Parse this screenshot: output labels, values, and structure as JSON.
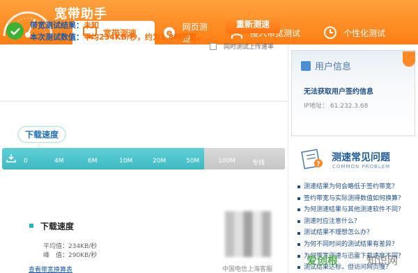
{
  "app": {
    "title": "宽带助手"
  },
  "tabs": [
    {
      "label": "宽带测速",
      "icon": "monitor-icon",
      "active": true
    },
    {
      "label": "网页测速",
      "icon": "browser-e-icon",
      "active": false
    },
    {
      "label": "接入带宽测试",
      "icon": "person-upload-icon",
      "active": false
    },
    {
      "label": "个性化测试",
      "icon": "clock-icon",
      "active": false
    }
  ],
  "result": {
    "result_label": "带宽测试结果：",
    "result_value": "未知",
    "value_label": "本次测试数值：",
    "value_value": "平均234KB/秒，约为1.8M带宽。",
    "retest_label": "重新测速",
    "upload_checkbox_label": "同时测试上传速率",
    "upload_checked": false
  },
  "speed": {
    "bubble_label": "下载速度",
    "ticks": [
      "0",
      "4M",
      "6M",
      "10M",
      "20M",
      "50M",
      "100M",
      "专线"
    ]
  },
  "stats": {
    "title": "下载速度",
    "avg": "平均值：234KB/秒",
    "peak": "峰　值：290KB/秒",
    "link": "查看带宽换算表",
    "qr_caption": "中国电信上海客服"
  },
  "user_panel": {
    "title": "用户信息",
    "no_info": "无法获取用户签约信息",
    "ip": "IP地址： 61.232.3.68"
  },
  "faq": {
    "title": "测速常见问题",
    "subtitle": "COMMON PROBLEM",
    "items": [
      "测速结果为何会略低于签约带宽？",
      "签约带宽与实际测得数值如何换算？",
      "为何测速结果与其他测速软件不同？",
      "测速时应注意什么？",
      "测试结果不理想怎么办？",
      "为何不同时间的测试结果有差异？",
      "为何带宽测速与迅雷下载速度不同？",
      "测试结果达标，但访问网页慢？"
    ]
  },
  "watermark": {
    "text1": "爱创根",
    "text2": "知识网"
  },
  "colors": {
    "accent": "#ff7d13",
    "teal": "#3fb9c0",
    "link": "#1c5aa8",
    "success": "#3bb232"
  }
}
